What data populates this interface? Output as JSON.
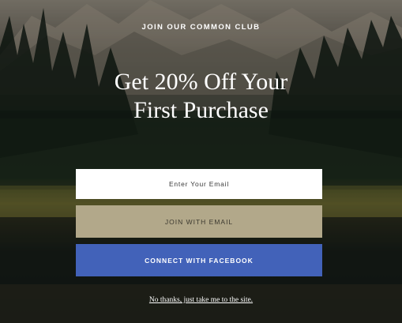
{
  "popup": {
    "kicker": "JOIN OUR COMMON CLUB",
    "headline_line1": "Get 20% Off Your",
    "headline_line2": "First Purchase",
    "email_placeholder": "Enter Your Email",
    "join_email_label": "JOIN WITH EMAIL",
    "facebook_label": "CONNECT WITH FACEBOOK",
    "decline_link": "No thanks, just take me to the site."
  },
  "colors": {
    "join_button": "#b2a88a",
    "facebook_button": "#4262b9"
  }
}
